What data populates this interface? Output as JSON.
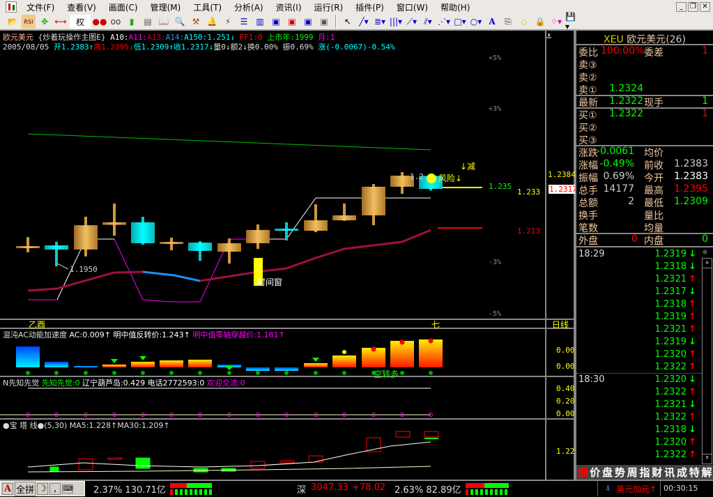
{
  "menu": {
    "items": [
      "文件(F)",
      "查看(V)",
      "画面(C)",
      "管理(M)",
      "工具(T)",
      "分析(A)",
      "资讯(I)",
      "运行(R)",
      "插件(P)",
      "窗口(W)",
      "帮助(H)"
    ]
  },
  "toolbar": {
    "quan": "权",
    "rsi": "RSI",
    "text_tool": "A"
  },
  "info1": {
    "name": "欧元美元",
    "formula": "{炒着玩操作主图E}",
    "a10": "A10:",
    "a11": "A11:",
    "a13": "A13:",
    "a14": "A14:",
    "a150": "A150:1.251↓",
    "ff1": "FF1:0",
    "year": "上市年:1999",
    "month": "月:1"
  },
  "info2": {
    "date": "2005/08/05",
    "open": "开1.2383↑",
    "high": "高1.2395↓",
    "low": "低1.2309↑",
    "close": "收1.2317↓",
    "vol": "量0↓",
    "amt": "额2↓",
    "turn": "换0.00%",
    "amp": "振0.69%",
    "chg": "涨(-0.0067)-0.54%"
  },
  "main_chart": {
    "pct_ticks": [
      "+5%",
      "+3%",
      "-3%",
      "-5%"
    ],
    "labels": {
      "low_mark": "1.1950",
      "high_mark": "1.2",
      "risk": "风险↓",
      "reduce": "↓减",
      "time_window": "时间窗",
      "lvl_green": "1.235",
      "lvl_yellow": "1.233",
      "lvl_red": "1.213",
      "prev_close": "1.2384",
      "last": "1.2317"
    },
    "candles": [
      [
        1.2024,
        1.2073,
        1.1996,
        1.2024
      ],
      [
        1.2031,
        1.2049,
        1.1925,
        1.201
      ],
      [
        1.201,
        1.2176,
        1.1975,
        1.2133
      ],
      [
        1.2135,
        1.2243,
        1.208,
        1.2148
      ],
      [
        1.2148,
        1.2176,
        1.2035,
        1.2042
      ],
      [
        1.2042,
        1.207,
        1.2006,
        1.2045
      ],
      [
        1.2045,
        1.2052,
        1.1953,
        1.2003
      ],
      [
        1.1999,
        1.2066,
        1.1939,
        1.2042
      ],
      [
        1.2042,
        1.2137,
        1.2013,
        1.2109
      ],
      [
        1.2112,
        1.2148,
        1.2056,
        1.2109
      ],
      [
        1.2105,
        1.2239,
        1.2098,
        1.2158
      ],
      [
        1.2158,
        1.2243,
        1.2155,
        1.2183
      ],
      [
        1.2183,
        1.2342,
        1.2133,
        1.2328
      ],
      [
        1.2328,
        1.2402,
        1.2292,
        1.2384
      ],
      [
        1.2383,
        1.2395,
        1.2309,
        1.2317
      ]
    ],
    "date_left": "乙酉",
    "date_right": "七",
    "period": "日线"
  },
  "ac_panel": {
    "title": "混沌AC动能加速度",
    "ac": "AC:0.009↑",
    "rev": "明中值反转价:1.243↑",
    "zero": "明中值零轴穿越价:1.181↑",
    "signal": "空转多",
    "axis": [
      "0.00",
      "0.00"
    ],
    "values": [
      30,
      8,
      2,
      4,
      8,
      10,
      11,
      4,
      -5,
      -5,
      6,
      17,
      28,
      38,
      40
    ],
    "colors": [
      "blue",
      "blue",
      "blue",
      "warm",
      "warm",
      "warm",
      "warm",
      "blue",
      "blue",
      "blue",
      "warm",
      "warm",
      "warm",
      "warm",
      "warm"
    ]
  },
  "n_panel": {
    "title": "N先知先觉",
    "a": "先知先觉:0",
    "b": "辽宁葫芦岛:0.429",
    "c": "电话2772593:0",
    "d": "欢迎交流:0",
    "axis": [
      "0.40",
      "0.20",
      "0.00"
    ]
  },
  "bt_panel": {
    "title": "●宝 塔 线●",
    "params": "(5,30)",
    "ma5": "MA5:1.228↑",
    "ma30": "MA30:1.209↑",
    "axis": "1.22"
  },
  "quote": {
    "code": "XEU",
    "name": "欧元美元",
    "count": "(26)",
    "wb_label": "委比",
    "wb": "100.00%",
    "wc_label": "委差",
    "wc": "1",
    "s3": "卖③",
    "s2": "卖②",
    "s1": "卖①",
    "s1p": "1.2324",
    "last_label": "最新",
    "last": "1.2322",
    "xs_label": "现手",
    "xs": "1",
    "b1": "买①",
    "b1p": "1.2322",
    "b1v": "1",
    "b2": "买②",
    "b3": "买③",
    "rows": [
      [
        "涨跌",
        "-0.0061",
        "均价",
        ""
      ],
      [
        "涨幅",
        "-0.49%",
        "前收",
        "1.2383"
      ],
      [
        "振幅",
        "0.69%",
        "今开",
        "1.2383"
      ],
      [
        "总手",
        "14177",
        "最高",
        "1.2395"
      ],
      [
        "总额",
        "2",
        "最低",
        "1.2309"
      ],
      [
        "换手",
        "",
        "量比",
        ""
      ],
      [
        "笔数",
        "",
        "均量",
        ""
      ]
    ],
    "wp_label": "外盘",
    "wp": "0",
    "np_label": "内盘",
    "np": "0"
  },
  "ticks": {
    "groups": [
      {
        "time": "18:29",
        "items": [
          [
            "1.2319",
            "down"
          ],
          [
            "1.2318",
            "down"
          ],
          [
            "1.2321",
            "up"
          ],
          [
            "1.2317",
            "down"
          ],
          [
            "1.2318",
            "up"
          ],
          [
            "1.2319",
            "up"
          ],
          [
            "1.2321",
            "up"
          ],
          [
            "1.2319",
            "down"
          ],
          [
            "1.2320",
            "up"
          ],
          [
            "1.2322",
            "up"
          ]
        ]
      },
      {
        "time": "18:30",
        "items": [
          [
            "1.2320",
            "down"
          ],
          [
            "1.2322",
            "up"
          ],
          [
            "1.2321",
            "down"
          ],
          [
            "1.2322",
            "up"
          ],
          [
            "1.2318",
            "down"
          ],
          [
            "1.2320",
            "up"
          ],
          [
            "1.2322",
            "up"
          ]
        ]
      }
    ]
  },
  "tabs": [
    "细",
    "价",
    "盘",
    "势",
    "周",
    "指",
    "财",
    "讯",
    "成",
    "特",
    "解"
  ],
  "statusbar": {
    "ime": [
      "A",
      "全拼"
    ],
    "sh": "2.37% 130.71亿",
    "sz_label": "深",
    "sz_idx": "3047.33",
    "sz_chg": "+78.02",
    "sz_pct": "2.63% 82.89亿",
    "alert": "美元加元↑",
    "clock": "00:30:15"
  }
}
